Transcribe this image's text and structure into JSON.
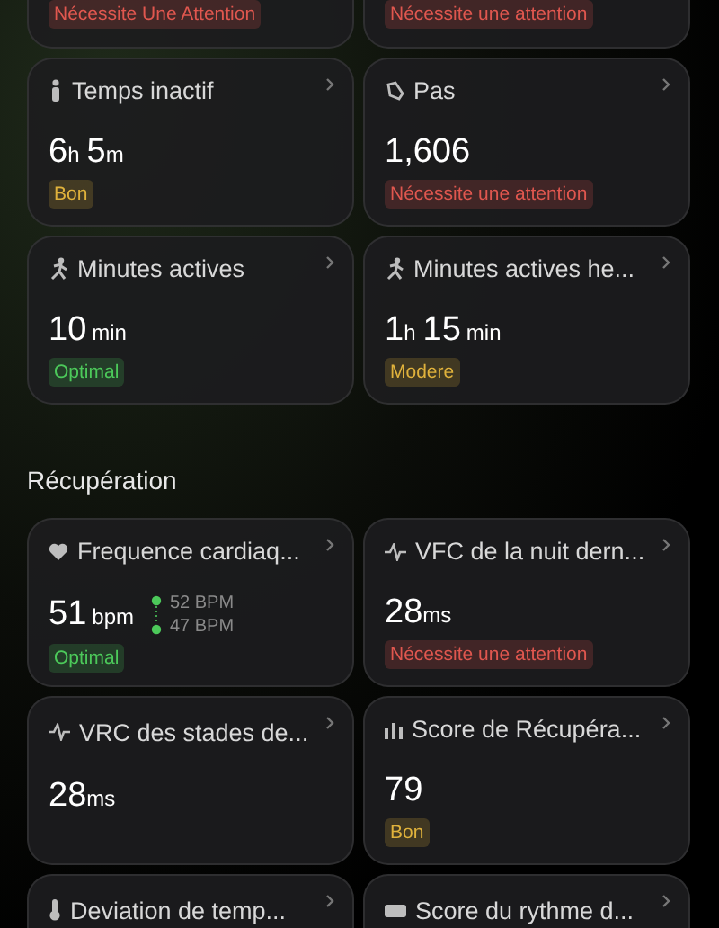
{
  "top_cards": [
    {
      "status": {
        "label": "Nécessite Une Attention",
        "kind": "alert"
      }
    },
    {
      "status": {
        "label": "Nécessite une attention",
        "kind": "alert"
      }
    }
  ],
  "activity_cards": [
    {
      "title": "Temps inactif",
      "value": [
        {
          "text": "6",
          "kind": "num"
        },
        {
          "text": "h",
          "kind": "unit"
        },
        {
          "text": "5",
          "kind": "num"
        },
        {
          "text": "m",
          "kind": "unit"
        }
      ],
      "status": {
        "label": "Bon",
        "kind": "fair"
      }
    },
    {
      "title": "Pas",
      "value": [
        {
          "text": "1,606",
          "kind": "num"
        }
      ],
      "status": {
        "label": "Nécessite une attention",
        "kind": "alert"
      }
    },
    {
      "title": "Minutes actives",
      "value": [
        {
          "text": "10",
          "kind": "num"
        },
        {
          "text": "min",
          "kind": "unit"
        }
      ],
      "status": {
        "label": "Optimal",
        "kind": "optimal"
      }
    },
    {
      "title": "Minutes actives he...",
      "value": [
        {
          "text": "1",
          "kind": "num"
        },
        {
          "text": "h",
          "kind": "unit"
        },
        {
          "text": "15",
          "kind": "num"
        },
        {
          "text": "min",
          "kind": "unit"
        }
      ],
      "status": {
        "label": "Modere",
        "kind": "fair"
      }
    }
  ],
  "section_title": "Récupération",
  "recovery_cards": [
    {
      "title": "Frequence cardiaq...",
      "value": [
        {
          "text": "51",
          "kind": "num"
        },
        {
          "text": "bpm",
          "kind": "unit"
        }
      ],
      "range": [
        "52 BPM",
        "47 BPM"
      ],
      "status": {
        "label": "Optimal",
        "kind": "optimal"
      }
    },
    {
      "title": "VFC de la nuit dern...",
      "value": [
        {
          "text": "28",
          "kind": "num"
        },
        {
          "text": "ms",
          "kind": "unit"
        }
      ],
      "status": {
        "label": "Nécessite une attention",
        "kind": "alert"
      }
    },
    {
      "title": "VRC des stades de...",
      "value": [
        {
          "text": "28",
          "kind": "num"
        },
        {
          "text": "ms",
          "kind": "unit"
        }
      ]
    },
    {
      "title": "Score de Récupéra...",
      "value": [
        {
          "text": "79",
          "kind": "num"
        }
      ],
      "status": {
        "label": "Bon",
        "kind": "fair"
      }
    },
    {
      "title": "Deviation de temp..."
    },
    {
      "title": "Score du rythme d..."
    }
  ]
}
